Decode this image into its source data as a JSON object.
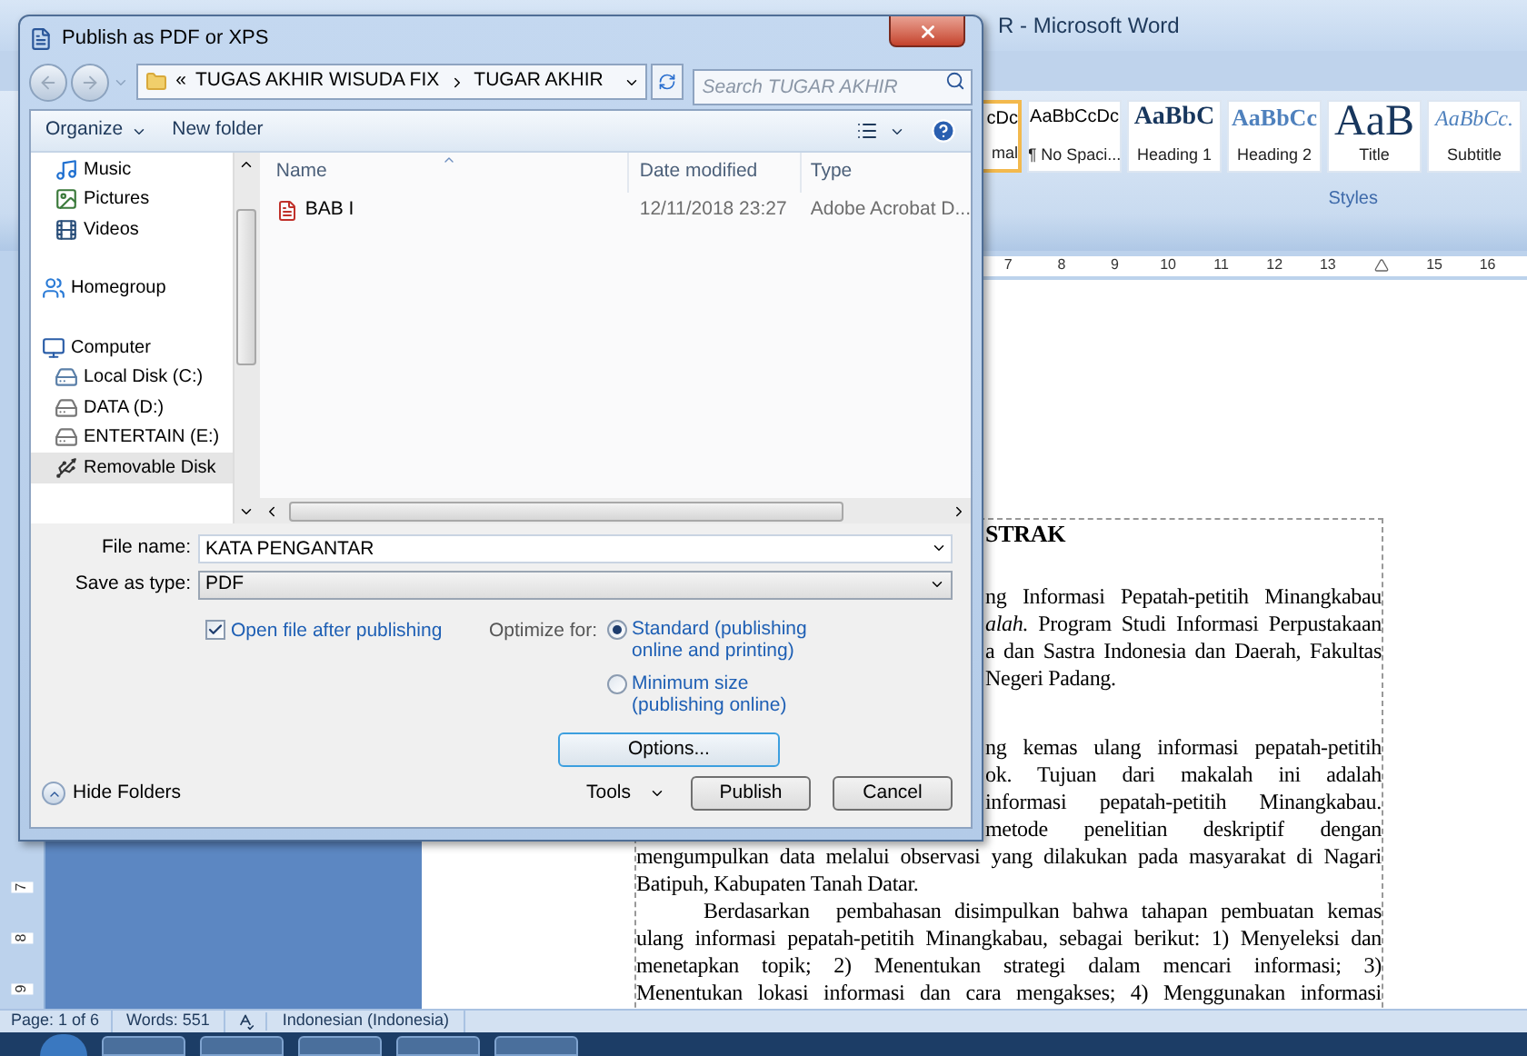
{
  "word": {
    "title": "R - Microsoft Word",
    "styles": [
      {
        "kind": "normal",
        "sample": "cDc",
        "label": "mal",
        "selected": true
      },
      {
        "kind": "normal",
        "sample": "AaBbCcDc",
        "label": "¶ No Spaci...",
        "selected": false
      },
      {
        "kind": "heading1",
        "sample": "AaBbC",
        "label": "Heading 1",
        "selected": false
      },
      {
        "kind": "heading2",
        "sample": "AaBbCc",
        "label": "Heading 2",
        "selected": false
      },
      {
        "kind": "title",
        "sample": "AaB",
        "label": "Title",
        "selected": false
      },
      {
        "kind": "subtitle",
        "sample": "AaBbCc.",
        "label": "Subtitle",
        "selected": false
      }
    ],
    "styles_group": "Styles",
    "ruler": [
      {
        "kind": "number",
        "text": "7"
      },
      {
        "kind": "number",
        "text": "8"
      },
      {
        "kind": "number",
        "text": "9"
      },
      {
        "kind": "number",
        "text": "10"
      },
      {
        "kind": "number",
        "text": "11"
      },
      {
        "kind": "number",
        "text": "12"
      },
      {
        "kind": "number",
        "text": "13"
      },
      {
        "kind": "marker"
      },
      {
        "kind": "number",
        "text": "15"
      },
      {
        "kind": "number",
        "text": "16"
      }
    ],
    "vertical_ruler": [
      "7",
      "8",
      "9"
    ],
    "document": {
      "heading": "STRAK",
      "sections": [
        [
          {
            "lines": [
              {
                "kind": "cut",
                "text": "ng Informasi Pepatah-petitih Minangkabau"
              },
              {
                "kind": "cut",
                "text": "*alah.* Program Studi Informasi Perpustakaan"
              },
              {
                "kind": "cut",
                "text": "a dan Sastra Indonesia dan Daerah, Fakultas"
              },
              {
                "kind": "cut-last",
                "text": "Negeri Padang."
              }
            ]
          }
        ],
        [
          {
            "lines": [
              {
                "kind": "cut",
                "text": "ng kemas ulang informasi pepatah-petitih"
              },
              {
                "kind": "cut",
                "text": "ok. Tujuan dari makalah ini adalah"
              },
              {
                "kind": "cut",
                "text": "informasi pepatah-petitih Minangkabau."
              },
              {
                "kind": "cut",
                "text": "metode penelitian deskriptif dengan"
              },
              {
                "kind": "full",
                "text": "mengumpulkan data melalui observasi yang dilakukan pada masyarakat di Nagari"
              },
              {
                "kind": "last",
                "text": "Batipuh, Kabupaten Tanah Datar."
              }
            ]
          },
          {
            "lines": [
              {
                "kind": "first",
                "text": "Berdasarkan  pembahasan disimpulkan bahwa tahapan pembuatan kemas"
              },
              {
                "kind": "full",
                "text": "ulang informasi pepatah-petitih Minangkabau, sebagai berikut: 1) Menyeleksi dan"
              },
              {
                "kind": "full",
                "text": "menetapkan topik; 2) Menentukan strategi dalam mencari informasi; 3)"
              },
              {
                "kind": "full",
                "text": "Menentukan lokasi informasi dan cara mengakses; 4) Menggunakan informasi"
              }
            ]
          }
        ]
      ]
    },
    "status_bar": {
      "page": "Page: 1 of 6",
      "words": "Words: 551",
      "language": "Indonesian (Indonesia)"
    }
  },
  "dialog": {
    "title": "Publish as PDF or XPS",
    "breadcrumb_overflow": "«",
    "breadcrumb": [
      "TUGAS AKHIR WISUDA FIX",
      "TUGAR AKHIR"
    ],
    "search": {
      "placeholder": "Search TUGAR AKHIR"
    },
    "toolbar": {
      "organize": "Organize",
      "new_folder": "New folder"
    },
    "nav": [
      {
        "children": [
          {
            "kind": "music",
            "label": "Music",
            "selected": false
          },
          {
            "kind": "pictures",
            "label": "Pictures",
            "selected": false
          },
          {
            "kind": "videos",
            "label": "Videos",
            "selected": false
          }
        ]
      },
      {
        "kind": "homegroup",
        "label": "Homegroup",
        "selected": false
      },
      {
        "kind": "computer",
        "label": "Computer",
        "selected": false,
        "children": [
          {
            "kind": "system-drive",
            "label": "Local Disk (C:)",
            "selected": false
          },
          {
            "kind": "drive",
            "label": "DATA (D:)",
            "selected": false
          },
          {
            "kind": "drive",
            "label": "ENTERTAIN (E:)",
            "selected": false
          },
          {
            "kind": "removable",
            "label": "Removable Disk",
            "selected": true
          }
        ]
      }
    ],
    "columns": [
      "Name",
      "Date modified",
      "Type"
    ],
    "files": [
      {
        "name": "BAB I",
        "date": "12/11/2018 23:27",
        "type": "Adobe Acrobat D..."
      }
    ],
    "file_name": {
      "label": "File name:",
      "value": "KATA PENGANTAR"
    },
    "save_as_type": {
      "label": "Save as type:",
      "value": "PDF"
    },
    "open_after": {
      "label": "Open file after publishing",
      "checked": true
    },
    "optimize": {
      "label": "Optimize for:",
      "options": [
        {
          "text": "Standard (publishing\nonline and printing)",
          "selected": true
        },
        {
          "text": "Minimum size\n(publishing online)",
          "selected": false
        }
      ]
    },
    "options_button": "Options...",
    "hide_folders": "Hide Folders",
    "tools": "Tools",
    "buttons": [
      "Publish",
      "Cancel"
    ]
  }
}
